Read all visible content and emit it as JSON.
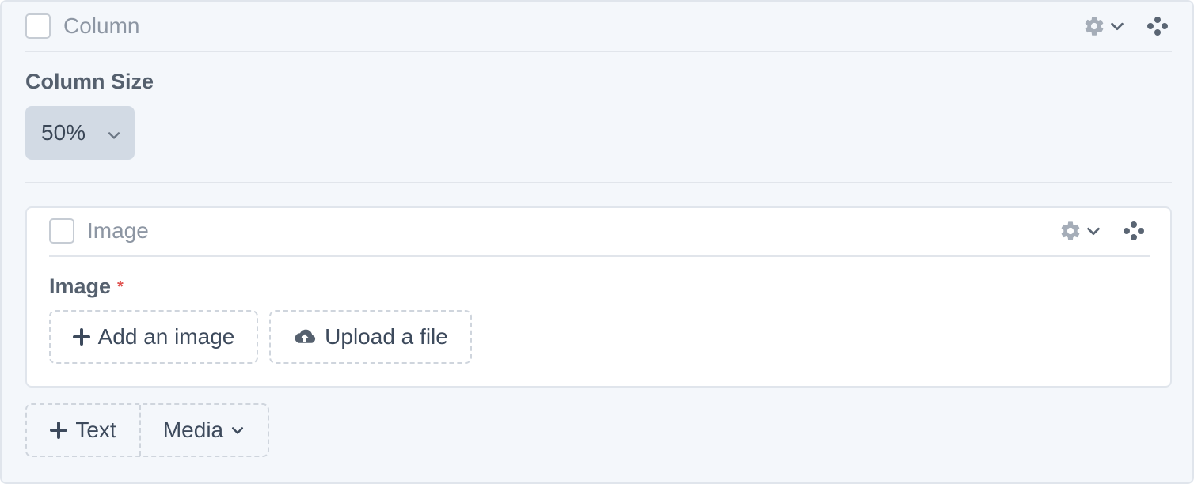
{
  "column_block": {
    "header_label": "Column",
    "size_field": {
      "label": "Column Size",
      "value": "50%"
    }
  },
  "image_block": {
    "header_label": "Image",
    "image_field": {
      "label": "Image",
      "required_mark": "*",
      "add_button_label": "Add an image",
      "upload_button_label": "Upload a file"
    }
  },
  "add_toolbar": {
    "text_button_label": "Text",
    "media_button_label": "Media"
  },
  "icons": {
    "settings": "gear-icon",
    "expand": "chevron-down-icon",
    "drag": "drag-handle-icon",
    "add": "plus-icon",
    "upload": "cloud-upload-icon"
  },
  "colors": {
    "panel_background": "#f4f7fb",
    "select_background": "#d2dae4",
    "required": "#e0524f",
    "icon_gray": "#a5adb8"
  }
}
